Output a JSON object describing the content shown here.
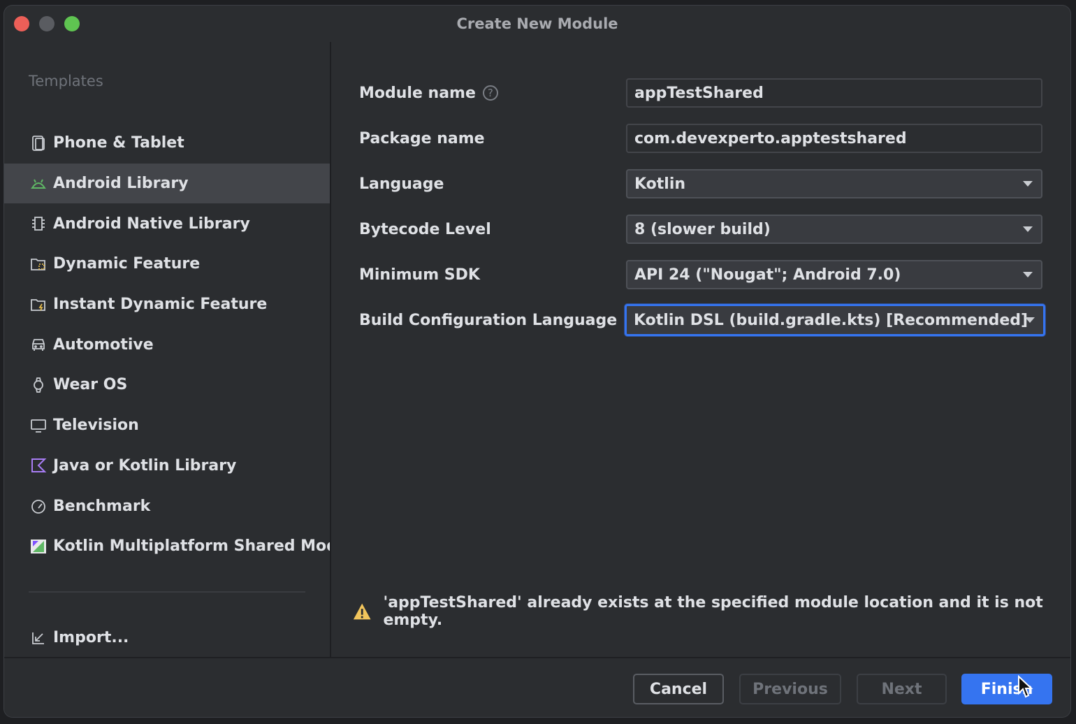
{
  "window": {
    "title": "Create New Module"
  },
  "sidebar": {
    "header": "Templates",
    "items": [
      {
        "label": "Phone & Tablet",
        "icon": "phone-tablet-icon",
        "selected": false
      },
      {
        "label": "Android Library",
        "icon": "android-icon",
        "selected": true
      },
      {
        "label": "Android Native Library",
        "icon": "chip-icon",
        "selected": false
      },
      {
        "label": "Dynamic Feature",
        "icon": "folder-dynamic-icon",
        "selected": false
      },
      {
        "label": "Instant Dynamic Feature",
        "icon": "folder-instant-icon",
        "selected": false
      },
      {
        "label": "Automotive",
        "icon": "car-icon",
        "selected": false
      },
      {
        "label": "Wear OS",
        "icon": "watch-icon",
        "selected": false
      },
      {
        "label": "Television",
        "icon": "tv-icon",
        "selected": false
      },
      {
        "label": "Java or Kotlin Library",
        "icon": "kotlin-icon",
        "selected": false
      },
      {
        "label": "Benchmark",
        "icon": "gauge-icon",
        "selected": false
      },
      {
        "label": "Kotlin Multiplatform Shared Mod...",
        "icon": "kmp-icon",
        "selected": false
      }
    ],
    "import_label": "Import..."
  },
  "form": {
    "module_name": {
      "label": "Module name",
      "value": "appTestShared"
    },
    "package_name": {
      "label": "Package name",
      "value": "com.devexperto.apptestshared"
    },
    "language": {
      "label": "Language",
      "value": "Kotlin"
    },
    "bytecode_level": {
      "label": "Bytecode Level",
      "value": "8 (slower build)"
    },
    "minimum_sdk": {
      "label": "Minimum SDK",
      "value": "API 24 (\"Nougat\"; Android 7.0)"
    },
    "build_config_language": {
      "label": "Build Configuration Language",
      "value": "Kotlin DSL (build.gradle.kts) [Recommended]"
    }
  },
  "warning": {
    "text": "'appTestShared' already exists at the specified module location and it is not empty."
  },
  "footer": {
    "cancel": "Cancel",
    "previous": "Previous",
    "next": "Next",
    "finish": "Finish"
  },
  "colors": {
    "accent": "#3574f0",
    "background": "#2b2d30",
    "warning": "#f2c55c"
  }
}
